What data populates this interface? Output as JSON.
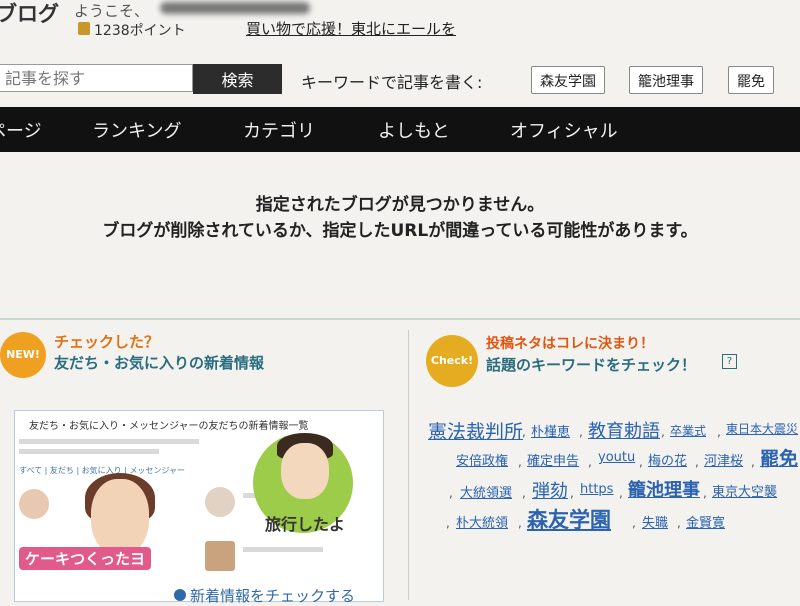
{
  "header": {
    "logo": "ブログ",
    "greeting": "ようこそ、",
    "points": "1238ポイント",
    "banner": "買い物で応援！東北にエールを"
  },
  "search": {
    "placeholder": "記事を探す",
    "button": "検索",
    "keyword_label": "キーワードで記事を書く:",
    "keywords": [
      "森友学園",
      "籠池理事",
      "罷免"
    ]
  },
  "nav": {
    "items": [
      "ページ",
      "ランキング",
      "カテゴリ",
      "よしもと",
      "オフィシャル"
    ]
  },
  "message": {
    "line1": "指定されたブログが見つかりません。",
    "line2": "ブログが削除されているか、指定したURLが間違っている可能性があります。"
  },
  "left_panel": {
    "badge": "NEW!",
    "subtitle": "チェックした？",
    "title": "友だち・お気に入りの新着情報",
    "preview": {
      "title": "友だち・お気に入り・メッセンジャーの友だちの新着情報一覧",
      "tabs": "すべて | 友だち | お気に入り | メッセンジャー",
      "cake_caption": "ケーキつくったヨ",
      "travel_caption": "旅行したよ"
    },
    "see_more": "新着情報をチェックする"
  },
  "right_panel": {
    "badge": "Check!",
    "subtitle": "投稿ネタはコレに決まり！",
    "title": "話題のキーワードをチェック！",
    "help": "?",
    "keywords": [
      "憲法裁判所",
      "朴槿恵",
      "教育勅語",
      "卒業式",
      "東日本大震災",
      "安倍政権",
      "確定申告",
      "youtu",
      "梅の花",
      "河津桜",
      "罷免",
      "大統領選",
      "弾劾",
      "https",
      "籠池理事",
      "東京大空襲",
      "朴大統領",
      "森友学園",
      "失職",
      "金賢寛"
    ]
  },
  "colors": {
    "nav_bg": "#111111",
    "link": "#2b63b0",
    "accent_orange": "#e45510",
    "title_teal": "#2a6d7f"
  }
}
